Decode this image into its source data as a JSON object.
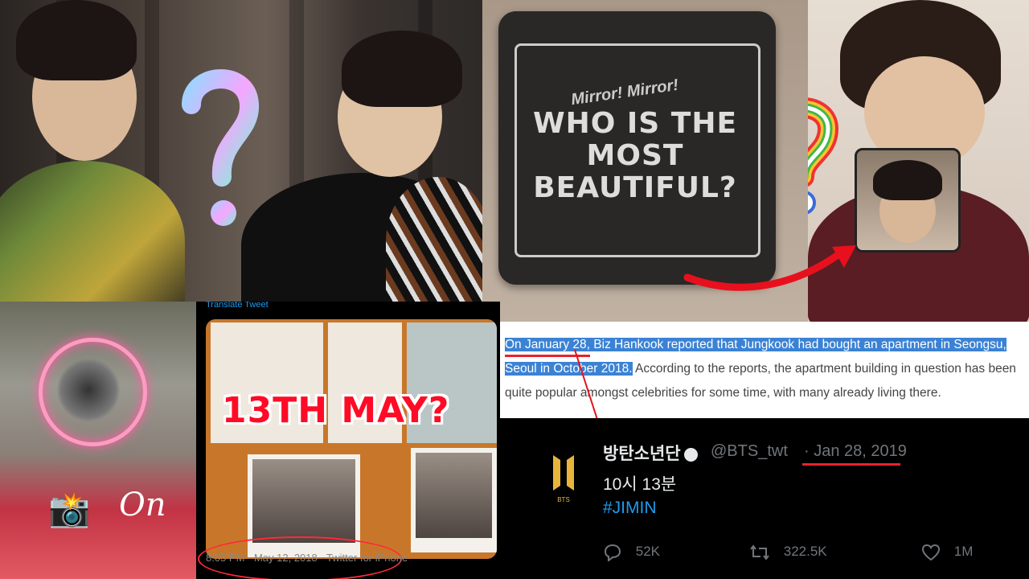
{
  "top_right_panel": {
    "sign": {
      "line_small": "Mirror! Mirror!",
      "line_main": [
        "WHO IS THE",
        "MOST",
        "BEAUTIFUL?"
      ]
    }
  },
  "bottom_left_panel": {
    "on_label": "On",
    "camera_emoji": "📸"
  },
  "photo_tweet": {
    "translate_link": "Translate Tweet",
    "overlay_text": "13TH MAY?",
    "timestamp": "8:05 PM · May 12, 2018 · Twitter for iPhone"
  },
  "article": {
    "highlighted_1": "On January 28, Biz Hankook reported that Jungkook had bought an apartment in Seongsu,",
    "highlighted_2": "Seoul in October 2018.",
    "rest": " According to the reports, the apartment building in question has been quite popular amongst celebrities for some time, with many already living there."
  },
  "bts_tweet": {
    "display_name": "방탄소년단",
    "handle": "@BTS_twt",
    "separator": "·",
    "date": "Jan 28, 2019",
    "text": "10시 13분",
    "hashtag": "#JIMIN",
    "replies": "52K",
    "retweets": "322.5K",
    "likes": "1M",
    "logo_text": "BTS"
  },
  "colors": {
    "twitter_blue": "#1d9bf0",
    "highlight_blue": "#3b82d4",
    "annotation_red": "#e8222e"
  }
}
